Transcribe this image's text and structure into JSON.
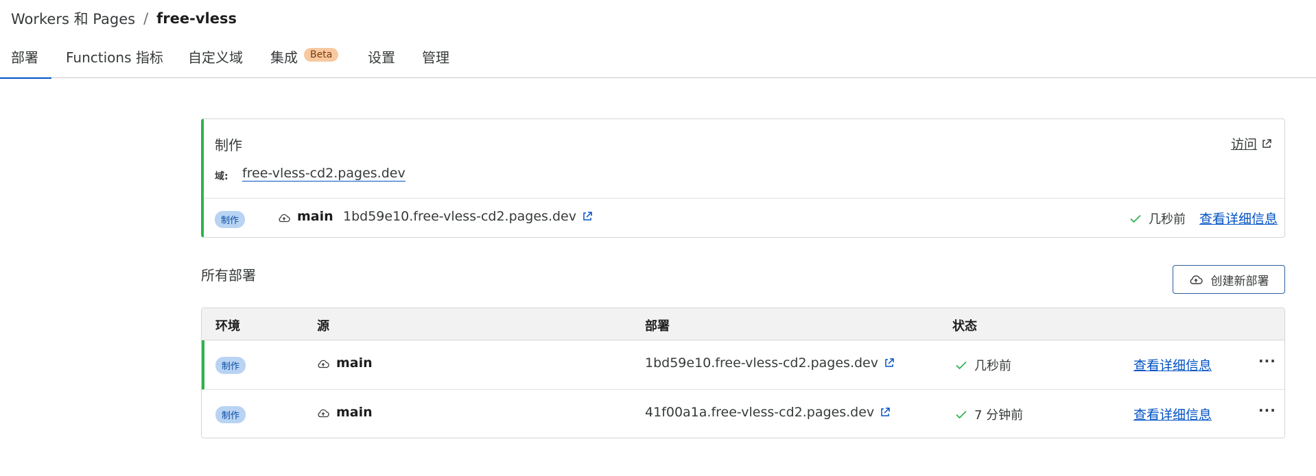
{
  "breadcrumb": {
    "parent": "Workers 和 Pages",
    "separator": "/",
    "current": "free-vless"
  },
  "tabs": [
    {
      "label": "部署",
      "active": true
    },
    {
      "label": "Functions 指标"
    },
    {
      "label": "自定义域"
    },
    {
      "label": "集成",
      "badge": "Beta"
    },
    {
      "label": "设置"
    },
    {
      "label": "管理"
    }
  ],
  "production": {
    "title": "制作",
    "visit_label": "访问",
    "domain_label": "域:",
    "domain": "free-vless-cd2.pages.dev",
    "deployment": {
      "env": "制作",
      "branch": "main",
      "url": "1bd59e10.free-vless-cd2.pages.dev",
      "status": "几秒前",
      "details": "查看详细信息"
    }
  },
  "all_deployments": {
    "title": "所有部署",
    "create_label": "创建新部署",
    "columns": [
      "环境",
      "源",
      "部署",
      "状态"
    ],
    "rows": [
      {
        "env": "制作",
        "branch": "main",
        "url": "1bd59e10.free-vless-cd2.pages.dev",
        "status": "几秒前",
        "details": "查看详细信息",
        "more": "···"
      },
      {
        "env": "制作",
        "branch": "main",
        "url": "41f00a1a.free-vless-cd2.pages.dev",
        "status": "7 分钟前",
        "details": "查看详细信息",
        "more": "···"
      }
    ]
  },
  "colors": {
    "accent": "#0051c3",
    "success": "#2fb24c",
    "env_pill_bg": "#b9d3f3",
    "beta_bg": "#f8c8a0"
  }
}
